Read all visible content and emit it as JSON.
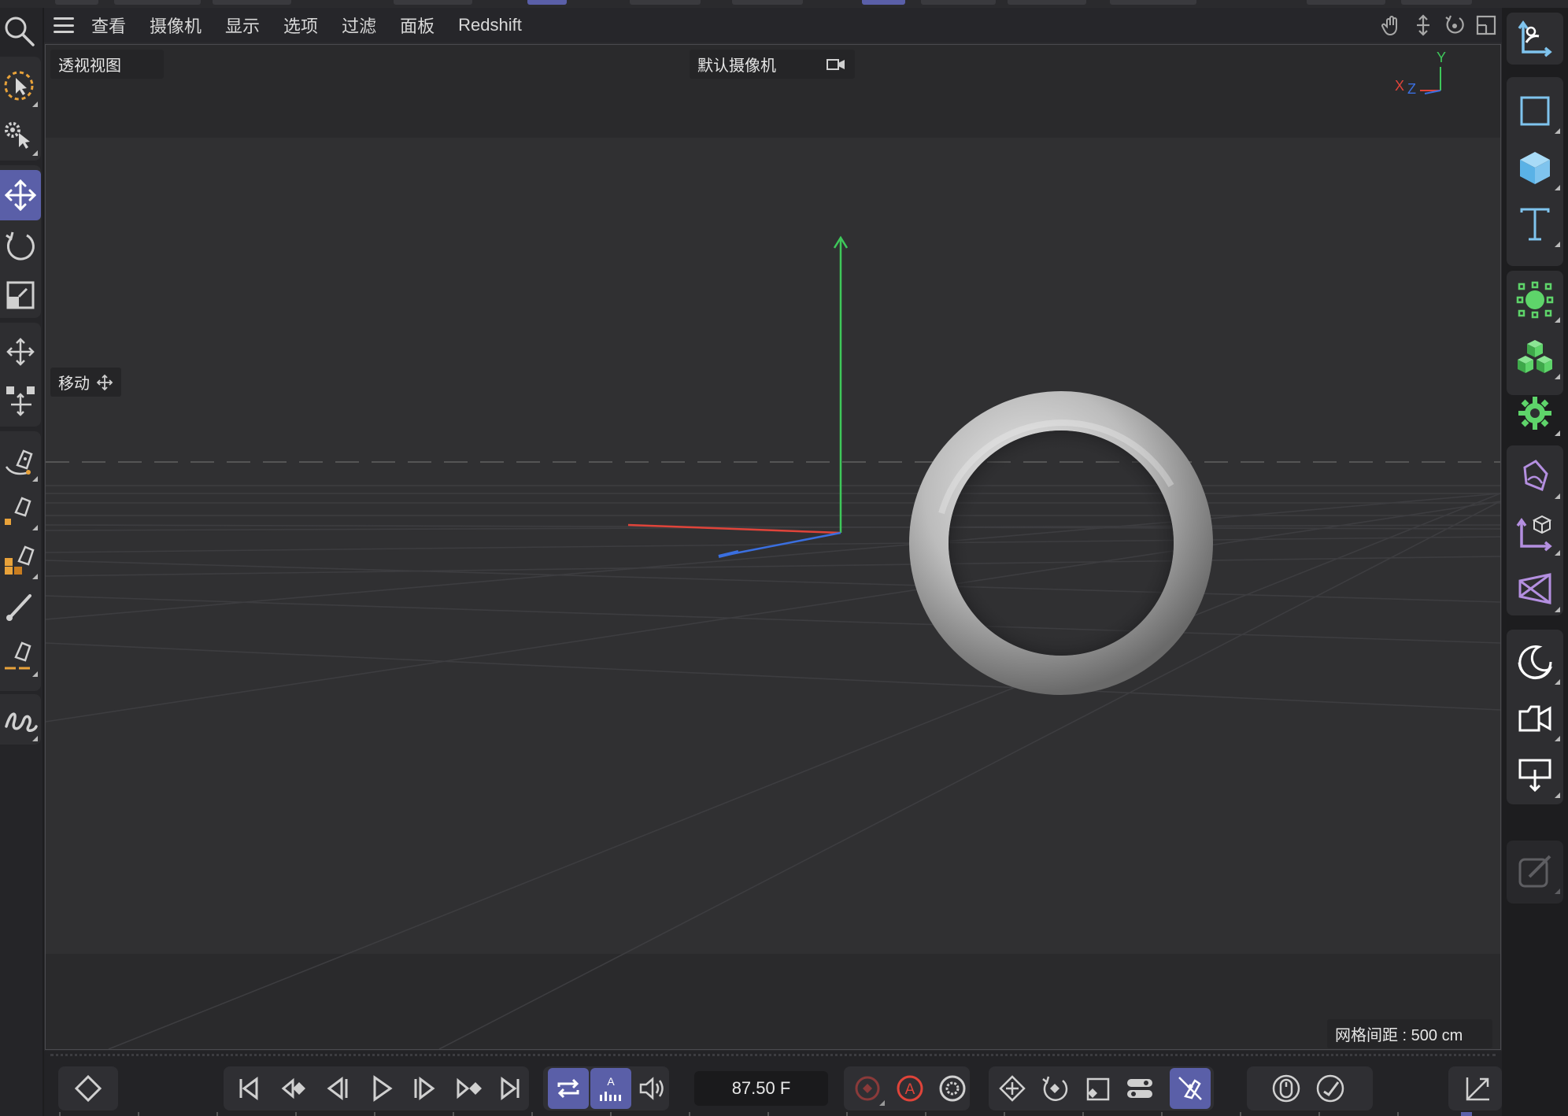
{
  "menu": {
    "items": [
      "查看",
      "摄像机",
      "显示",
      "选项",
      "过滤",
      "面板",
      "Redshift"
    ]
  },
  "viewport": {
    "view_name": "透视视图",
    "camera_name": "默认摄像机",
    "tool_label": "移动",
    "grid_spacing": "网格间距 : 500 cm",
    "axis_labels": {
      "y": "Y",
      "x": "X",
      "z": "Z"
    },
    "axis_colors": {
      "x": "#e0443a",
      "y": "#3ec85a",
      "z": "#3a6fe0"
    }
  },
  "timeline": {
    "frame_value": "87.50 F",
    "autokey_letter": "A"
  },
  "colors": {
    "accent": "#5a5fa8",
    "panel": "#2e2e31",
    "viewport_bg": "#303032",
    "spline_orange": "#e8a23a",
    "object_blue": "#7fc4ee",
    "generator_green": "#5ed46a",
    "deformer_purple": "#b48fe0"
  }
}
